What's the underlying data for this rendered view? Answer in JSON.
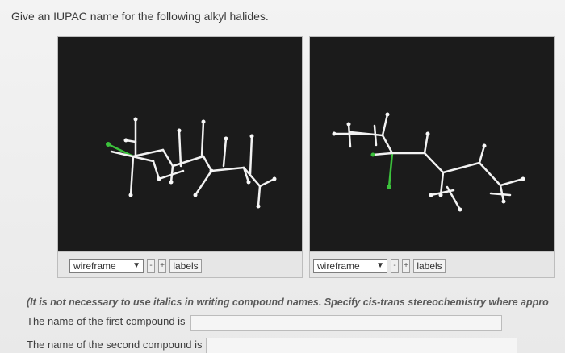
{
  "question": "Give an IUPAC name for the following alkyl halides.",
  "viewers": [
    {
      "render_mode": "wireframe",
      "minus_label": "-",
      "plus_label": "+",
      "labels_button": "labels"
    },
    {
      "render_mode": "wireframe",
      "minus_label": "-",
      "plus_label": "+",
      "labels_button": "labels"
    }
  ],
  "instructions": "(It is not necessary to use italics in writing compound names. Specify cis-trans stereochemistry where appro",
  "answers": {
    "first_prompt": "The name of the first compound is",
    "first_value": "",
    "second_prompt": "The name of the second compound is",
    "second_value": ""
  },
  "colors": {
    "canvas_bg": "#1b1b1b",
    "bond_white": "#f2f2f2",
    "halogen_green": "#3cc23c"
  }
}
